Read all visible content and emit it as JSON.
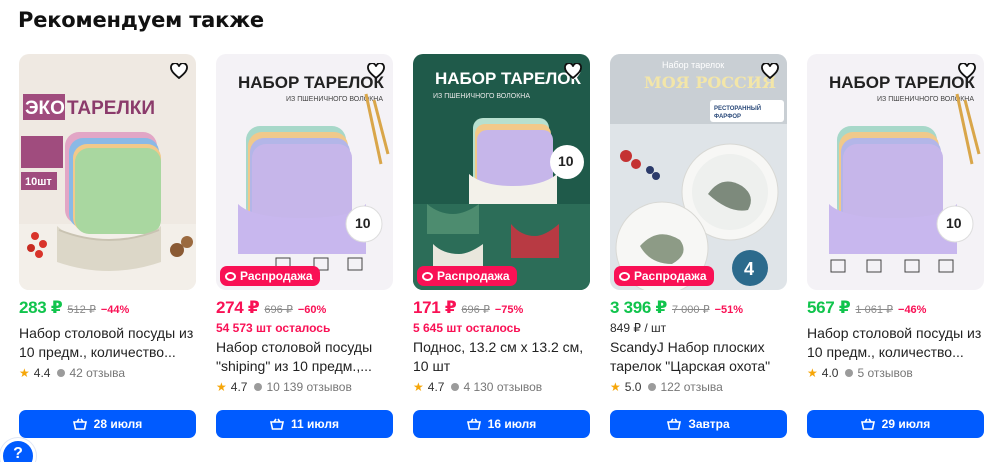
{
  "section": {
    "title": "Рекомендуем также"
  },
  "colors": {
    "accent": "#005bff",
    "price_green": "#10c44c",
    "sale_pink": "#f91155",
    "star": "#f6a609"
  },
  "products": [
    {
      "art": {
        "banner": "ЭКО ТАРЕЛКИ",
        "sub": "из пшеничной соломы",
        "count": "10шт"
      },
      "price": "283 ₽",
      "old_price": "512 ₽",
      "discount": "−44%",
      "price_color": "green",
      "sale_badge": "",
      "extra": "",
      "name": "Набор столовой посуды из 10 предм., количество...",
      "rating": "4.4",
      "reviews": "42 отзыва",
      "delivery": "28 июля"
    },
    {
      "art": {
        "banner": "НАБОР ТАРЕЛОК",
        "sub": "ИЗ ПШЕНИЧНОГО ВОЛОКНА",
        "count": "10"
      },
      "price": "274 ₽",
      "old_price": "696 ₽",
      "discount": "−60%",
      "price_color": "pink",
      "sale_badge": "Распродажа",
      "extra": "54 573 шт осталось",
      "name": "Набор столовой посуды \"shiping\" из 10 предм.,...",
      "rating": "4.7",
      "reviews": "10 139 отзывов",
      "delivery": "11 июля"
    },
    {
      "art": {
        "banner": "НАБОР ТАРЕЛОК",
        "sub": "ИЗ ПШЕНИЧНОГО ВОЛОКНА",
        "count": "10"
      },
      "price": "171 ₽",
      "old_price": "696 ₽",
      "discount": "−75%",
      "price_color": "pink",
      "sale_badge": "Распродажа",
      "extra": "5 645 шт осталось",
      "name": "Поднос, 13.2 см х 13.2 см, 10 шт",
      "rating": "4.7",
      "reviews": "4 130 отзывов",
      "delivery": "16 июля"
    },
    {
      "art": {
        "banner": "Набор тарелок",
        "title": "МОЯ РОССИЯ",
        "tag": "РЕСТОРАННЫЙ ФАРФОР",
        "count": "4"
      },
      "price": "3 396 ₽",
      "old_price": "7 000 ₽",
      "discount": "−51%",
      "price_color": "green",
      "sale_badge": "Распродажа",
      "extra": "849 ₽ / шт",
      "name": "ScandyJ Набор плоских тарелок \"Царская охота\" 4...",
      "rating": "5.0",
      "reviews": "122 отзыва",
      "delivery": "Завтра"
    },
    {
      "art": {
        "banner": "НАБОР ТАРЕЛОК",
        "sub": "ИЗ ПШЕНИЧНОГО ВОЛОКНА",
        "count": "10"
      },
      "price": "567 ₽",
      "old_price": "1 061 ₽",
      "discount": "−46%",
      "price_color": "green",
      "sale_badge": "",
      "extra": "",
      "name": "Набор столовой посуды из 10 предм., количество...",
      "rating": "4.0",
      "reviews": "5 отзывов",
      "delivery": "29 июля"
    }
  ],
  "help": {
    "label": "?"
  }
}
